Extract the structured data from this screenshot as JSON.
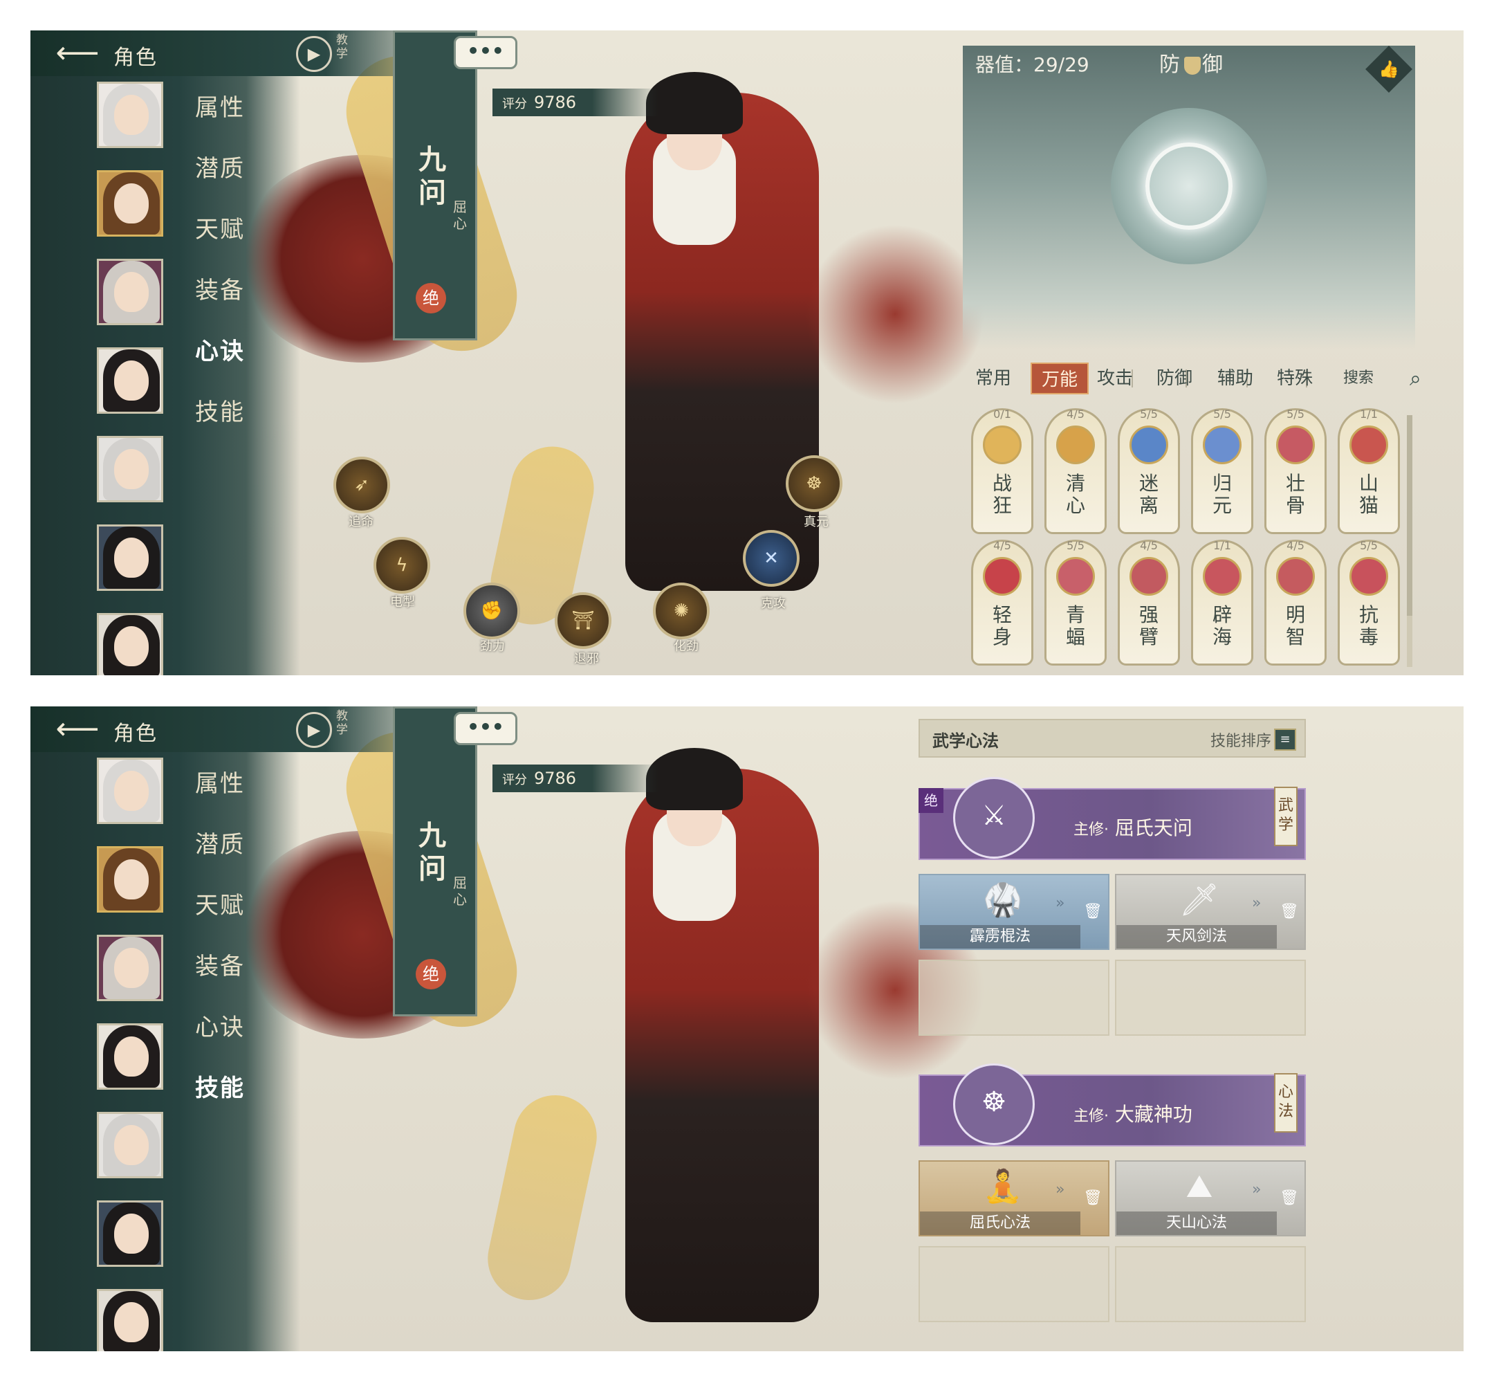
{
  "common": {
    "back_label": "角色",
    "tutorial_label": "教学",
    "character_name": "九问",
    "character_subtitle": "屈心",
    "grade": "绝",
    "score_label": "评分",
    "score_value": "9786",
    "chat_label": "•••",
    "menu": [
      "属性",
      "潜质",
      "天赋",
      "装备",
      "心诀",
      "技能"
    ]
  },
  "top": {
    "active_menu": "心诀",
    "skill_nodes": [
      {
        "label": "追命",
        "icon": "arrow-figure-icon"
      },
      {
        "label": "电掣",
        "icon": "lightning-icon"
      },
      {
        "label": "劲力",
        "icon": "fist-icon"
      },
      {
        "label": "退邪",
        "icon": "gate-icon"
      },
      {
        "label": "化劲",
        "icon": "swirl-icon"
      },
      {
        "label": "克攻",
        "icon": "crossed-blades-icon"
      },
      {
        "label": "真元",
        "icon": "meditation-icon"
      }
    ],
    "defense_panel": {
      "qi_value": "器值：29/29",
      "title_left": "防",
      "title_right": "御",
      "thumb": "👍"
    },
    "categories": [
      "常用",
      "万能",
      "攻击",
      "防御",
      "辅助",
      "特殊",
      "搜索"
    ],
    "active_category": "万能",
    "cards_row1": [
      {
        "count": "0/1",
        "name": "战狂",
        "color": "#e0b45a"
      },
      {
        "count": "4/5",
        "name": "清心",
        "color": "#d7a24a"
      },
      {
        "count": "5/5",
        "name": "迷离",
        "color": "#5a86c8"
      },
      {
        "count": "5/5",
        "name": "归元",
        "color": "#6b8fcf"
      },
      {
        "count": "5/5",
        "name": "壮骨",
        "color": "#c65a63"
      },
      {
        "count": "1/1",
        "name": "山猫",
        "color": "#c9564f"
      }
    ],
    "cards_row2": [
      {
        "count": "4/5",
        "name": "轻身",
        "color": "#c7434a"
      },
      {
        "count": "5/5",
        "name": "青蝠",
        "color": "#c8606a"
      },
      {
        "count": "4/5",
        "name": "强臂",
        "color": "#c25a60"
      },
      {
        "count": "1/1",
        "name": "辟海",
        "color": "#c8565e"
      },
      {
        "count": "4/5",
        "name": "明智",
        "color": "#c55b5f"
      },
      {
        "count": "5/5",
        "name": "抗毒",
        "color": "#c8525c"
      }
    ]
  },
  "bottom": {
    "active_menu": "技能",
    "header_title": "武学心法",
    "sort_label": "技能排序",
    "martial": {
      "main_prefix": "主修·",
      "main_name": "屈氏天问",
      "tag": "武学",
      "badge": "绝",
      "slots": [
        "霹雳棍法",
        "天风剑法"
      ]
    },
    "heart": {
      "main_prefix": "主修·",
      "main_name": "大藏神功",
      "tag": "心法",
      "slots": [
        "屈氏心法",
        "天山心法"
      ]
    }
  }
}
